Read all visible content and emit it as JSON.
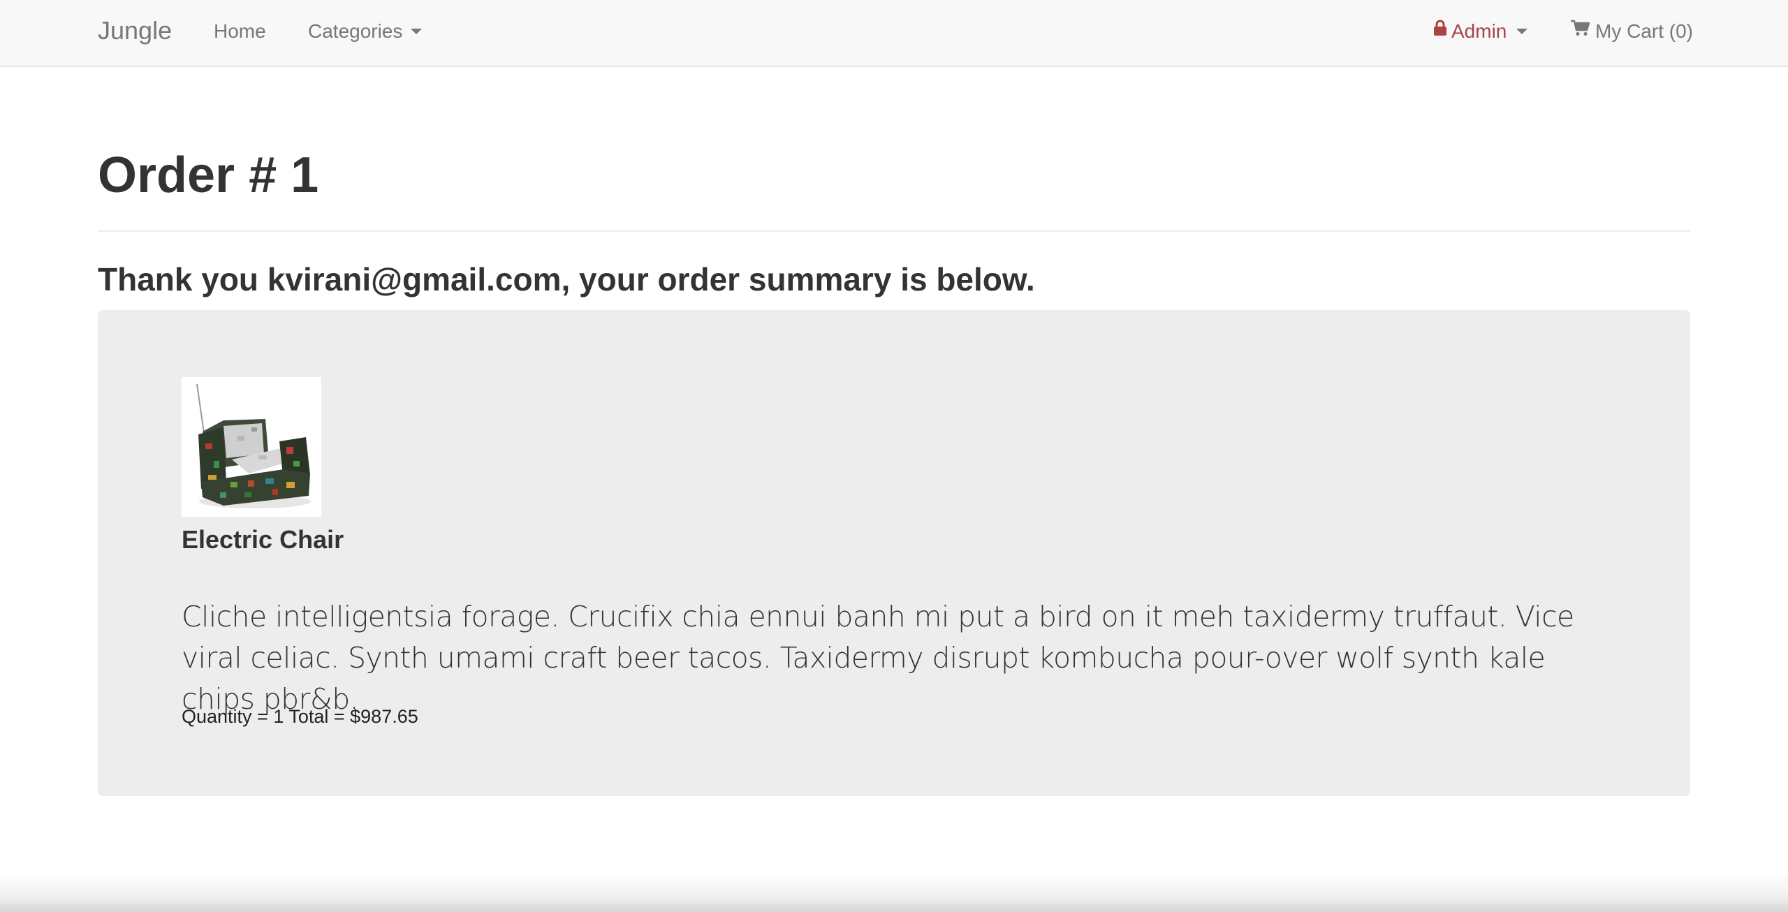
{
  "navbar": {
    "brand": "Jungle",
    "home_label": "Home",
    "categories_label": "Categories",
    "admin_label": "Admin",
    "cart_label": "My Cart (0)",
    "admin_color": "#a94442",
    "icons": {
      "admin": "lock-icon",
      "cart": "shopping-cart-icon",
      "dropdown": "caret-down-icon"
    }
  },
  "page": {
    "title": "Order # 1",
    "thanks": "Thank you kvirani@gmail.com, your order summary is below."
  },
  "order": {
    "items": [
      {
        "name": "Electric Chair",
        "description": "Cliche intelligentsia forage. Crucifix chia ennui banh mi put a bird on it meh taxidermy truffaut. Vice viral celiac. Synth umami craft beer tacos. Taxidermy disrupt kombucha pour-over wolf synth kale chips pbr&b.",
        "summary": "Quantity = 1 Total = $987.65",
        "image": "electric-chair-product-photo"
      }
    ]
  }
}
